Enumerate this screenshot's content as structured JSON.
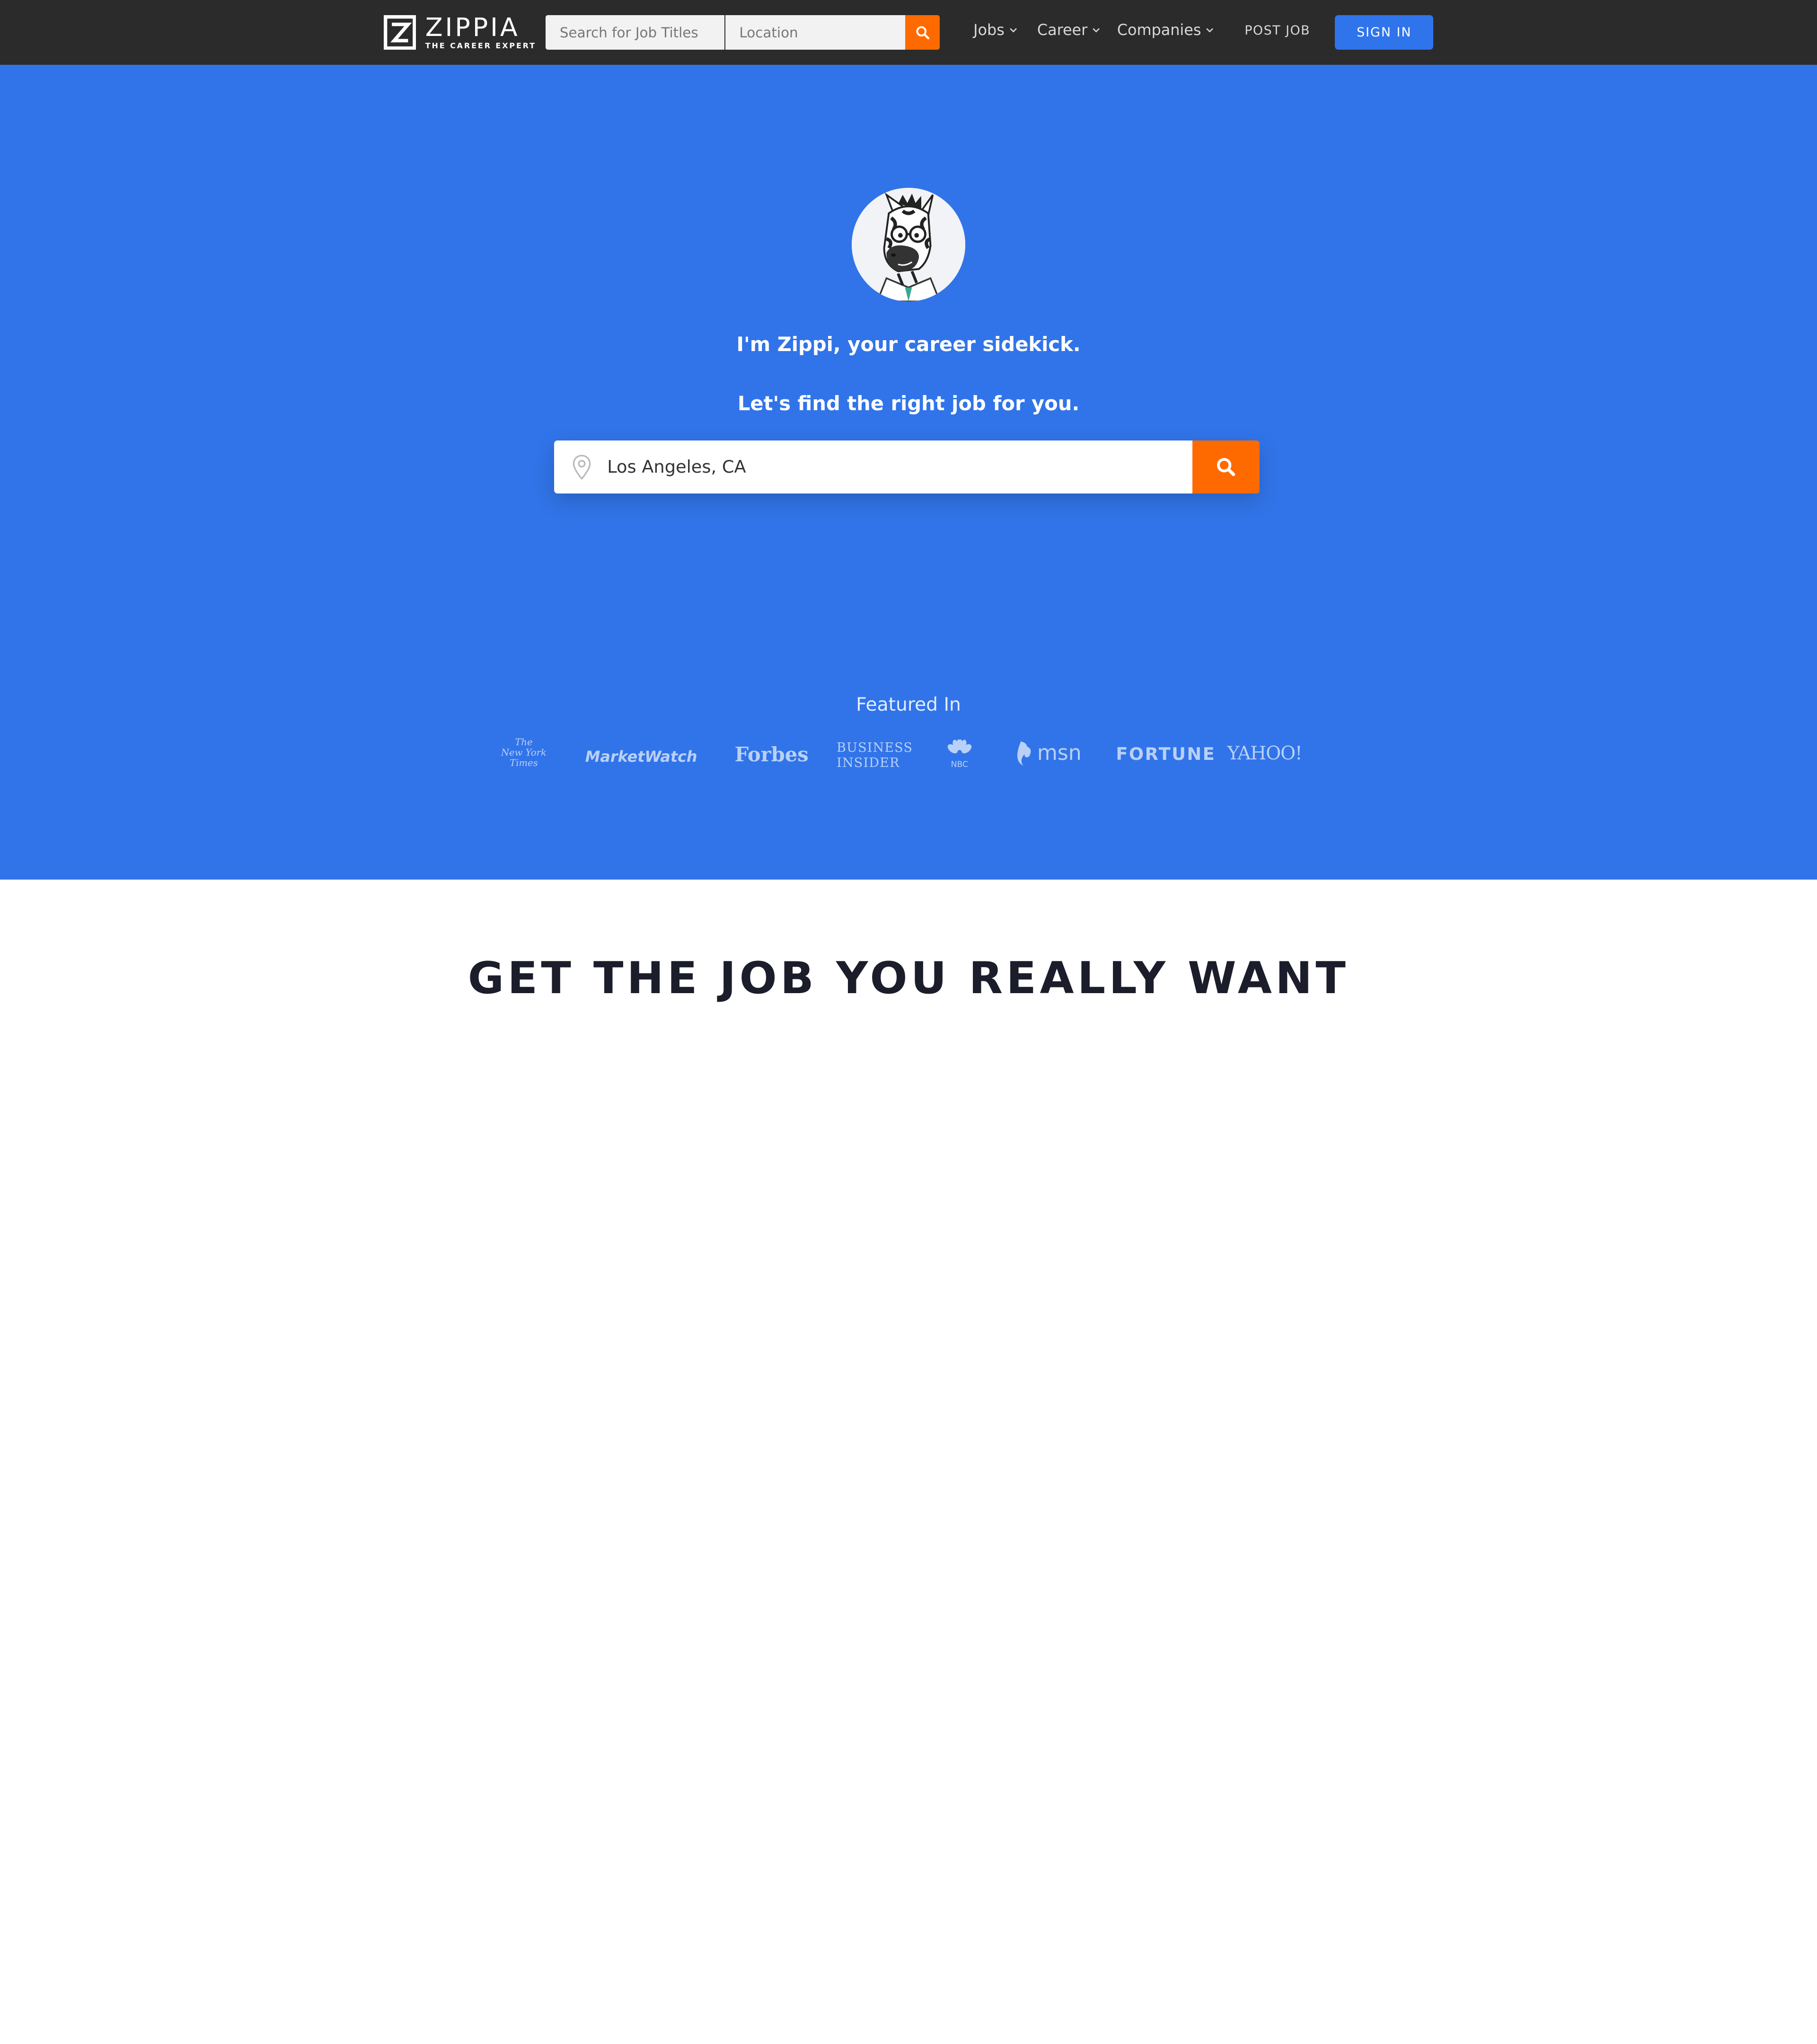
{
  "header": {
    "logo_name": "ZIPPIA",
    "logo_tagline": "THE CAREER EXPERT",
    "search_jobs_placeholder": "Search for Job Titles",
    "search_location_placeholder": "Location",
    "menu": [
      {
        "label": "Jobs"
      },
      {
        "label": "Career"
      },
      {
        "label": "Companies"
      }
    ],
    "post_job_label": "POST JOB",
    "sign_in_label": "SIGN IN"
  },
  "hero": {
    "intro": "I'm Zippi, your career sidekick.",
    "prompt": "Let's find the right job for you.",
    "location_value": "Los Angeles, CA",
    "featured_heading": "Featured In",
    "press": {
      "nyt": [
        "The",
        "New York",
        "Times"
      ],
      "marketwatch": "MarketWatch",
      "forbes": "Forbes",
      "business_insider": [
        "BUSINESS",
        "INSIDER"
      ],
      "nbc": "NBC",
      "msn": "msn",
      "fortune": "FORTUNE",
      "yahoo": "YAHOO!"
    }
  },
  "section": {
    "title": "GET THE JOB YOU REALLY WANT"
  },
  "colors": {
    "topbar": "#2b2b2b",
    "hero": "#3174e9",
    "accent_orange": "#ff6a00",
    "sign_in": "#2f74eb"
  }
}
